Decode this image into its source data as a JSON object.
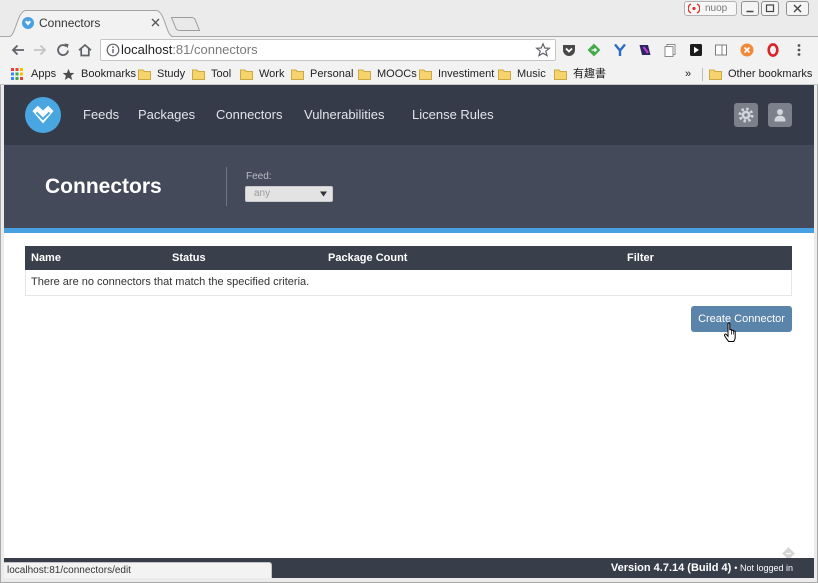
{
  "browser": {
    "tab": {
      "title": "Connectors"
    },
    "profile": {
      "label": "nuop"
    },
    "address": {
      "host": "localhost",
      "path": ":81/connectors"
    },
    "bookmarks": {
      "apps_label": "Apps",
      "bookmarks_label": "Bookmarks",
      "folders": [
        "Study",
        "Tool",
        "Work",
        "Personal",
        "MOOCs",
        "Investiment",
        "Music",
        "有趣書"
      ],
      "overflow_label": "»",
      "other_label": "Other bookmarks"
    },
    "status_url": "localhost:81/connectors/edit"
  },
  "app": {
    "nav": [
      "Feeds",
      "Packages",
      "Connectors",
      "Vulnerabilities",
      "License Rules"
    ],
    "page_title": "Connectors",
    "feed_filter": {
      "label": "Feed:",
      "selected": "any"
    },
    "table": {
      "columns": [
        "Name",
        "Status",
        "Package Count",
        "Filter"
      ],
      "empty_message": "There are no connectors that match the specified criteria."
    },
    "create_button_label": "Create Connector",
    "footer": {
      "version": "Version 4.7.14 (Build 4)",
      "login_status": "• Not logged in"
    }
  },
  "icons": {
    "tab": [
      "connectors-favicon-icon",
      "close-icon",
      "new-tab-icon"
    ],
    "window": [
      "profile-icon",
      "minimize-icon",
      "maximize-icon",
      "close-window-icon"
    ],
    "navigation": [
      "back-arrow-icon",
      "forward-arrow-icon",
      "reload-icon",
      "home-icon",
      "info-icon",
      "star-icon"
    ],
    "extensions": [
      "pocket-icon",
      "green-diamond-icon",
      "y-icon",
      "purple-extension-icon",
      "pages-icon",
      "play-icon",
      "reader-icon",
      "orange-x-icon",
      "red-o-icon",
      "chrome-menu-icon"
    ],
    "bookmarks": [
      "apps-grid-icon",
      "bookmark-star-icon",
      "folder-icon"
    ],
    "app": [
      "proget-logo-icon",
      "gear-icon",
      "user-icon",
      "dropdown-arrow-icon",
      "hand-cursor-icon",
      "watermark-icon"
    ]
  },
  "colors": {
    "frame": "#ebebeb",
    "toolbar": "#f2f2f2",
    "page-bg": "#ffffff",
    "nav-bg": "#363b4a",
    "subheader-bg": "#444a5a",
    "accent-stripe": "#47a0e2",
    "logo-blue": "#49a6e0",
    "table-header-bg": "#3a3f4c",
    "button-bg": "#5a84aa",
    "footer-bg": "#383d4a"
  }
}
